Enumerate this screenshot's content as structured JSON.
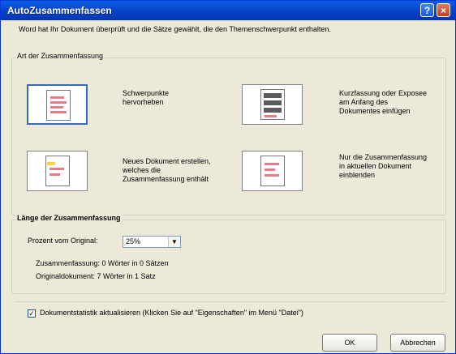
{
  "window": {
    "title": "AutoZusammenfassen",
    "help_label": "?",
    "close_label": "×"
  },
  "intro": "Word hat Ihr Dokument überprüft und die Sätze gewählt, die den Themenschwerpunkt enthalten.",
  "summary_type": {
    "label": "Art der Zusammenfassung",
    "options": [
      {
        "label": "Schwerpunkte hervorheben",
        "selected": true
      },
      {
        "label": "Kurzfassung oder Exposee am Anfang des Dokumentes einfügen",
        "selected": false
      },
      {
        "label": "Neues Dokument erstellen, welches die Zusammenfassung enthält",
        "selected": false
      },
      {
        "label": "Nur die Zusammenfassung in aktuellen Dokument einblenden",
        "selected": false
      }
    ]
  },
  "length": {
    "label": "Länge der Zusammenfassung",
    "percent_label": "Prozent vom Original:",
    "percent_value": "25%",
    "summary_text": "Zusammenfassung: 0 Wörter in 0 Sätzen",
    "original_text": "Originaldokument:   7 Wörter in 1 Satz"
  },
  "statistics": {
    "checked": true,
    "label": "Dokumentstatistik aktualisieren (Klicken Sie auf \"Eigenschaften\" im Menü \"Datei\")"
  },
  "buttons": {
    "ok": "OK",
    "cancel": "Abbrechen"
  },
  "colors": {
    "accent": "#3169c6",
    "highlight": "#e97b89",
    "dialog": "#ece9d8"
  }
}
